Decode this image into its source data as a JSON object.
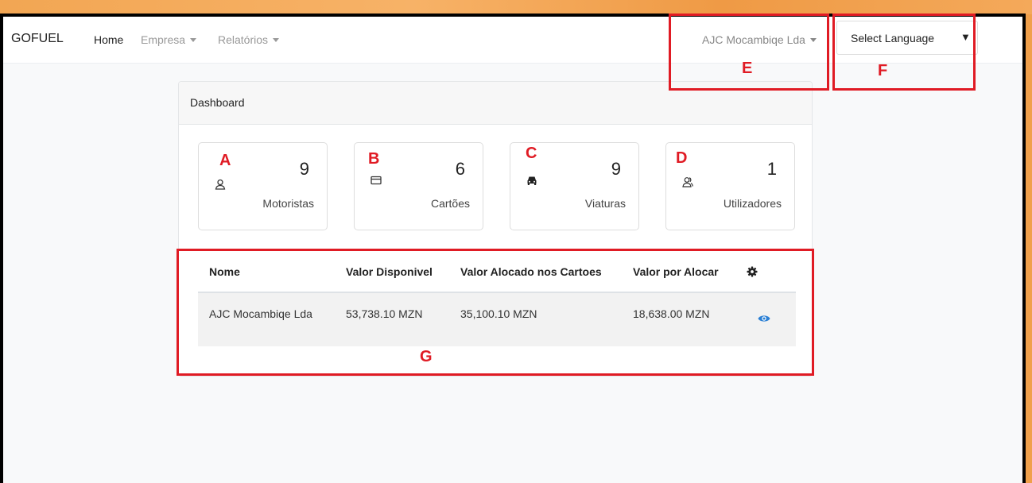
{
  "navbar": {
    "brand": "GOFUEL",
    "links": [
      {
        "label": "Home",
        "active": true
      },
      {
        "label": "Empresa",
        "dropdown": true
      },
      {
        "label": "Relatórios",
        "dropdown": true
      }
    ],
    "company": "AJC Mocambiqe Lda",
    "language_select": "Select Language"
  },
  "dashboard": {
    "title": "Dashboard",
    "stats": [
      {
        "value": "9",
        "label": "Motoristas",
        "icon": "user-icon",
        "marker": "A"
      },
      {
        "value": "6",
        "label": "Cartões",
        "icon": "credit-card-icon",
        "marker": "B"
      },
      {
        "value": "9",
        "label": "Viaturas",
        "icon": "car-icon",
        "marker": "C"
      },
      {
        "value": "1",
        "label": "Utilizadores",
        "icon": "users-icon",
        "marker": "D"
      }
    ],
    "table": {
      "headers": [
        "Nome",
        "Valor Disponivel",
        "Valor Alocado nos Cartoes",
        "Valor por Alocar"
      ],
      "settings_icon": "gear-icon",
      "rows": [
        {
          "nome": "AJC Mocambiqe Lda",
          "disponivel": "53,738.10 MZN",
          "alocado": "35,100.10 MZN",
          "por_alocar": "18,638.00 MZN",
          "action_icon": "eye-icon"
        }
      ]
    }
  },
  "annotations": {
    "company_marker": "E",
    "language_marker": "F",
    "table_marker": "G",
    "color": "#e01b24"
  },
  "colors": {
    "background_orange": "#f0a04b",
    "accent_blue": "#2a7fd4"
  }
}
